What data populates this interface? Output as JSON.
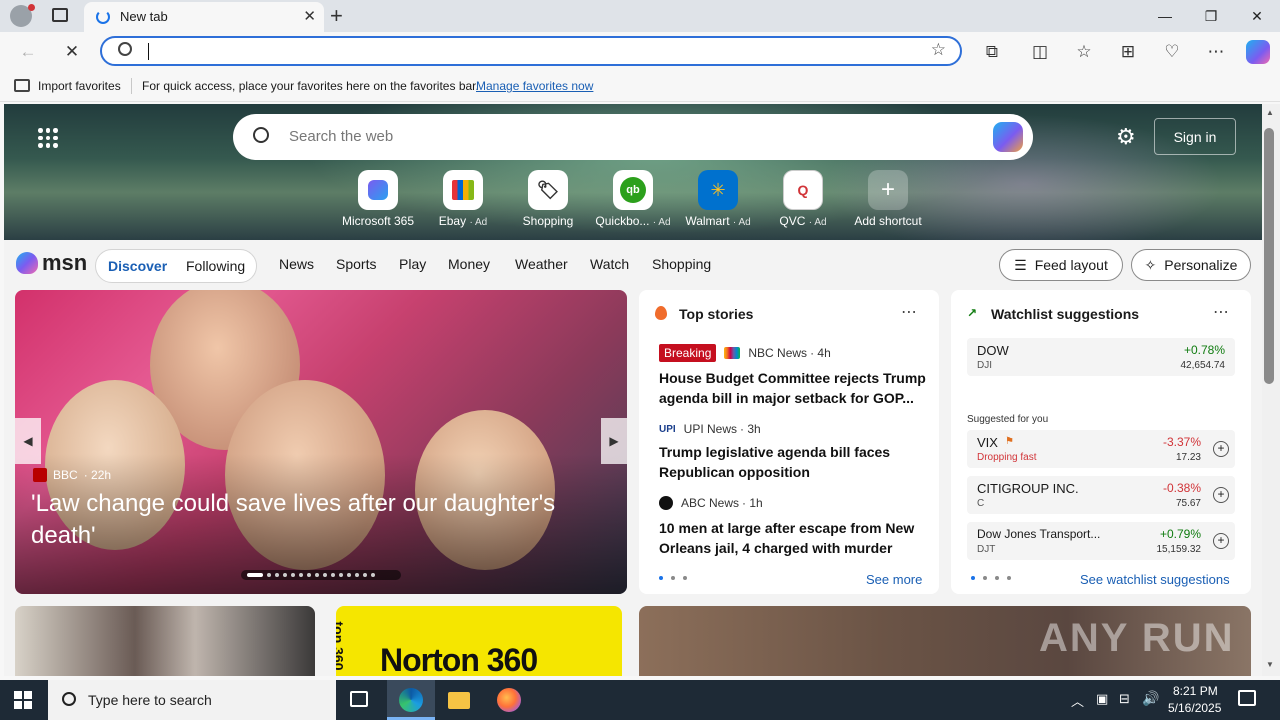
{
  "browser": {
    "tab_title": "New tab",
    "new_tab_symbol": "+",
    "favbar": {
      "import_label": "Import favorites",
      "hint": "For quick access, place your favorites here on the favorites bar.",
      "manage_link": "Manage favorites now"
    }
  },
  "msn": {
    "search_placeholder": "Search the web",
    "sign_in": "Sign in",
    "shortcuts": [
      {
        "label": "Microsoft 365",
        "ad": ""
      },
      {
        "label": "Ebay",
        "ad": "· Ad"
      },
      {
        "label": "Shopping",
        "ad": ""
      },
      {
        "label": "Quickbo...",
        "ad": "· Ad"
      },
      {
        "label": "Walmart",
        "ad": "· Ad"
      },
      {
        "label": "QVC",
        "ad": "· Ad"
      },
      {
        "label": "Add shortcut",
        "ad": ""
      }
    ],
    "logo": "msn",
    "nav": {
      "discover": "Discover",
      "following": "Following",
      "items": [
        "News",
        "Sports",
        "Play",
        "Money",
        "Weather",
        "Watch",
        "Shopping"
      ],
      "feed_layout": "Feed layout",
      "personalize": "Personalize"
    },
    "hero": {
      "source": "BBC",
      "age": "· 22h",
      "headline": "'Law change could save lives after our daughter's death'"
    },
    "top_stories": {
      "title": "Top stories",
      "stories": [
        {
          "badge": "Breaking",
          "source": "NBC News",
          "age": "· 4h",
          "headline": "House Budget Committee rejects Trump agenda bill in major setback for GOP..."
        },
        {
          "badge": "",
          "source": "UPI News",
          "age": "· 3h",
          "headline": "Trump legislative agenda bill faces Republican opposition"
        },
        {
          "badge": "",
          "source": "ABC News",
          "age": "· 1h",
          "headline": "10 men at large after escape from New Orleans jail, 4 charged with murder"
        }
      ],
      "see_more": "See more"
    },
    "watchlist": {
      "title": "Watchlist suggestions",
      "primary": {
        "name": "DOW",
        "symbol": "DJI",
        "change": "+0.78%",
        "price": "42,654.74"
      },
      "suggested_label": "Suggested for you",
      "suggested": [
        {
          "name": "VIX",
          "symbol": "Dropping fast",
          "change": "-3.37%",
          "price": "17.23"
        },
        {
          "name": "CITIGROUP INC.",
          "symbol": "C",
          "change": "-0.38%",
          "price": "75.67"
        },
        {
          "name": "Dow Jones Transport...",
          "symbol": "DJT",
          "change": "+0.79%",
          "price": "15,159.32"
        }
      ],
      "see_link": "See watchlist suggestions"
    },
    "bottom_cards": {
      "norton": "Norton 360",
      "norton_side": "ton 360"
    },
    "watermark": "ANY RUN"
  },
  "taskbar": {
    "search_placeholder": "Type here to search",
    "time": "8:21 PM",
    "date": "5/16/2025"
  },
  "colors": {
    "accent": "#2e6fd8",
    "positive": "#107c10",
    "negative": "#d13438",
    "breaking": "#c50f1f"
  }
}
